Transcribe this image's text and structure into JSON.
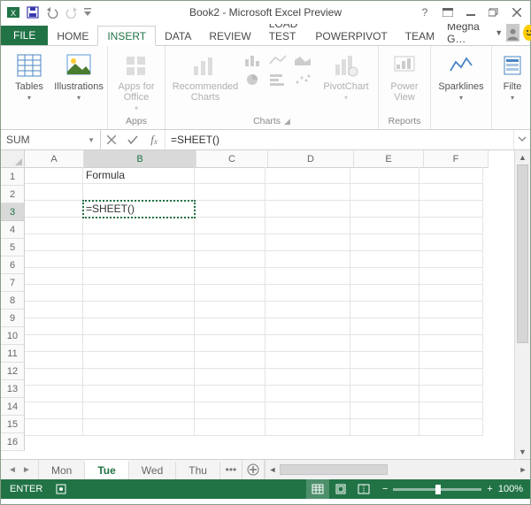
{
  "window": {
    "title": "Book2 - Microsoft Excel Preview"
  },
  "ribbon": {
    "tabs": [
      "FILE",
      "HOME",
      "INSERT",
      "DATA",
      "REVIEW",
      "LOAD TEST",
      "POWERPIVOT",
      "TEAM"
    ],
    "active": "INSERT",
    "signin": "Megha G…"
  },
  "groups": {
    "tables": {
      "btn_tables": "Tables",
      "btn_illustrations": "Illustrations",
      "label": ""
    },
    "apps": {
      "btn": "Apps for Office",
      "label": "Apps"
    },
    "charts": {
      "recommended": "Recommended Charts",
      "pivotchart": "PivotChart",
      "label": "Charts"
    },
    "reports": {
      "powerview": "Power View",
      "label": "Reports"
    },
    "sparklines": {
      "btn": "Sparklines",
      "label": ""
    },
    "filters": {
      "btn": "Filte",
      "label": ""
    }
  },
  "formula_bar": {
    "name": "SUM",
    "formula": "=SHEET()"
  },
  "columns": [
    "A",
    "B",
    "C",
    "D",
    "E",
    "F"
  ],
  "rows_count": 16,
  "cells": {
    "B1": "Formula",
    "B3": "=SHEET()"
  },
  "active_row": 3,
  "active_col": "B",
  "sheets": [
    "Mon",
    "Tue",
    "Wed",
    "Thu"
  ],
  "active_sheet": "Tue",
  "status": {
    "mode": "ENTER",
    "zoom": "100%"
  }
}
